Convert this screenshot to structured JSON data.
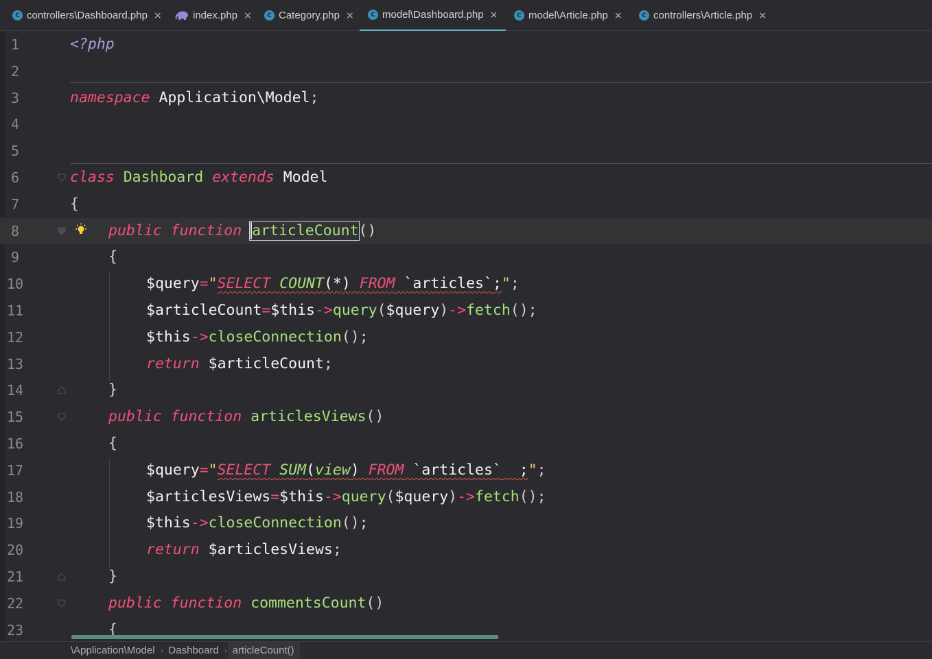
{
  "tabs": [
    {
      "label": "controllers\\Dashboard.php",
      "icon": "php-class-icon",
      "active": false
    },
    {
      "label": "index.php",
      "icon": "php-elephant-icon",
      "active": false
    },
    {
      "label": "Category.php",
      "icon": "php-class-icon",
      "active": false
    },
    {
      "label": "model\\Dashboard.php",
      "icon": "php-class-icon",
      "active": true
    },
    {
      "label": "model\\Article.php",
      "icon": "php-class-icon",
      "active": false
    },
    {
      "label": "controllers\\Article.php",
      "icon": "php-class-icon",
      "active": false
    }
  ],
  "tab_class_glyph": "C",
  "tab_close_glyph": "×",
  "code": {
    "line_numbers": [
      "1",
      "2",
      "3",
      "4",
      "5",
      "6",
      "7",
      "8",
      "9",
      "10",
      "11",
      "12",
      "13",
      "14",
      "15",
      "16",
      "17",
      "18",
      "19",
      "20",
      "21",
      "22",
      "23"
    ],
    "l1": {
      "php_open": "<?php"
    },
    "l3": {
      "kw": "namespace",
      "ns": "Application\\Model",
      "semi": ";"
    },
    "l6": {
      "kw1": "class",
      "name": "Dashboard",
      "kw2": "extends",
      "parent": "Model"
    },
    "l7": {
      "brace": "{"
    },
    "l8": {
      "kw1": "public",
      "kw2": "function",
      "name": "articleCount",
      "parens": "()"
    },
    "l9": {
      "brace": "{"
    },
    "l10": {
      "var": "$query",
      "eq": "=",
      "q1": "\"",
      "s1": "SELECT",
      "s2": "COUNT",
      "p1": "(",
      "star": "*",
      "p2": ")",
      "s3": "FROM",
      "tbl": "`articles`",
      "semi1": ";",
      "q2": "\"",
      "semi2": ";"
    },
    "l11": {
      "var": "$articleCount",
      "eq": "=",
      "this": "$this",
      "arrow1": "->",
      "m1": "query",
      "p1": "(",
      "arg": "$query",
      "p2": ")",
      "arrow2": "->",
      "m2": "fetch",
      "end": "();"
    },
    "l12": {
      "this": "$this",
      "arrow": "->",
      "m": "closeConnection",
      "end": "();"
    },
    "l13": {
      "kw": "return",
      "var": "$articleCount",
      "semi": ";"
    },
    "l14": {
      "brace": "}"
    },
    "l15": {
      "kw1": "public",
      "kw2": "function",
      "name": "articlesViews",
      "parens": "()"
    },
    "l16": {
      "brace": "{"
    },
    "l17": {
      "var": "$query",
      "eq": "=",
      "q1": "\"",
      "s1": "SELECT",
      "s2": "SUM",
      "p1": "(",
      "col": "view",
      "p2": ")",
      "s3": "FROM",
      "tbl": "`articles`",
      "semi1": ";",
      "q2": "\"",
      "semi2": ";"
    },
    "l18": {
      "var": "$articlesViews",
      "eq": "=",
      "this": "$this",
      "arrow1": "->",
      "m1": "query",
      "p1": "(",
      "arg": "$query",
      "p2": ")",
      "arrow2": "->",
      "m2": "fetch",
      "end": "();"
    },
    "l19": {
      "this": "$this",
      "arrow": "->",
      "m": "closeConnection",
      "end": "();"
    },
    "l20": {
      "kw": "return",
      "var": "$articlesViews",
      "semi": ";"
    },
    "l21": {
      "brace": "}"
    },
    "l22": {
      "kw1": "public",
      "kw2": "function",
      "name": "commentsCount",
      "parens": "()"
    },
    "l23": {
      "brace": "{"
    }
  },
  "breadcrumb": {
    "items": [
      "\\Application\\Model",
      "Dashboard",
      "articleCount()"
    ],
    "separator": "›"
  },
  "colors": {
    "keyword": "#f0507a",
    "identifier": "#a6e07a",
    "string": "#f0c674",
    "php_tag": "#a99bde",
    "active_tab_underline": "#5fb0c4",
    "background": "#2b2b2f"
  }
}
